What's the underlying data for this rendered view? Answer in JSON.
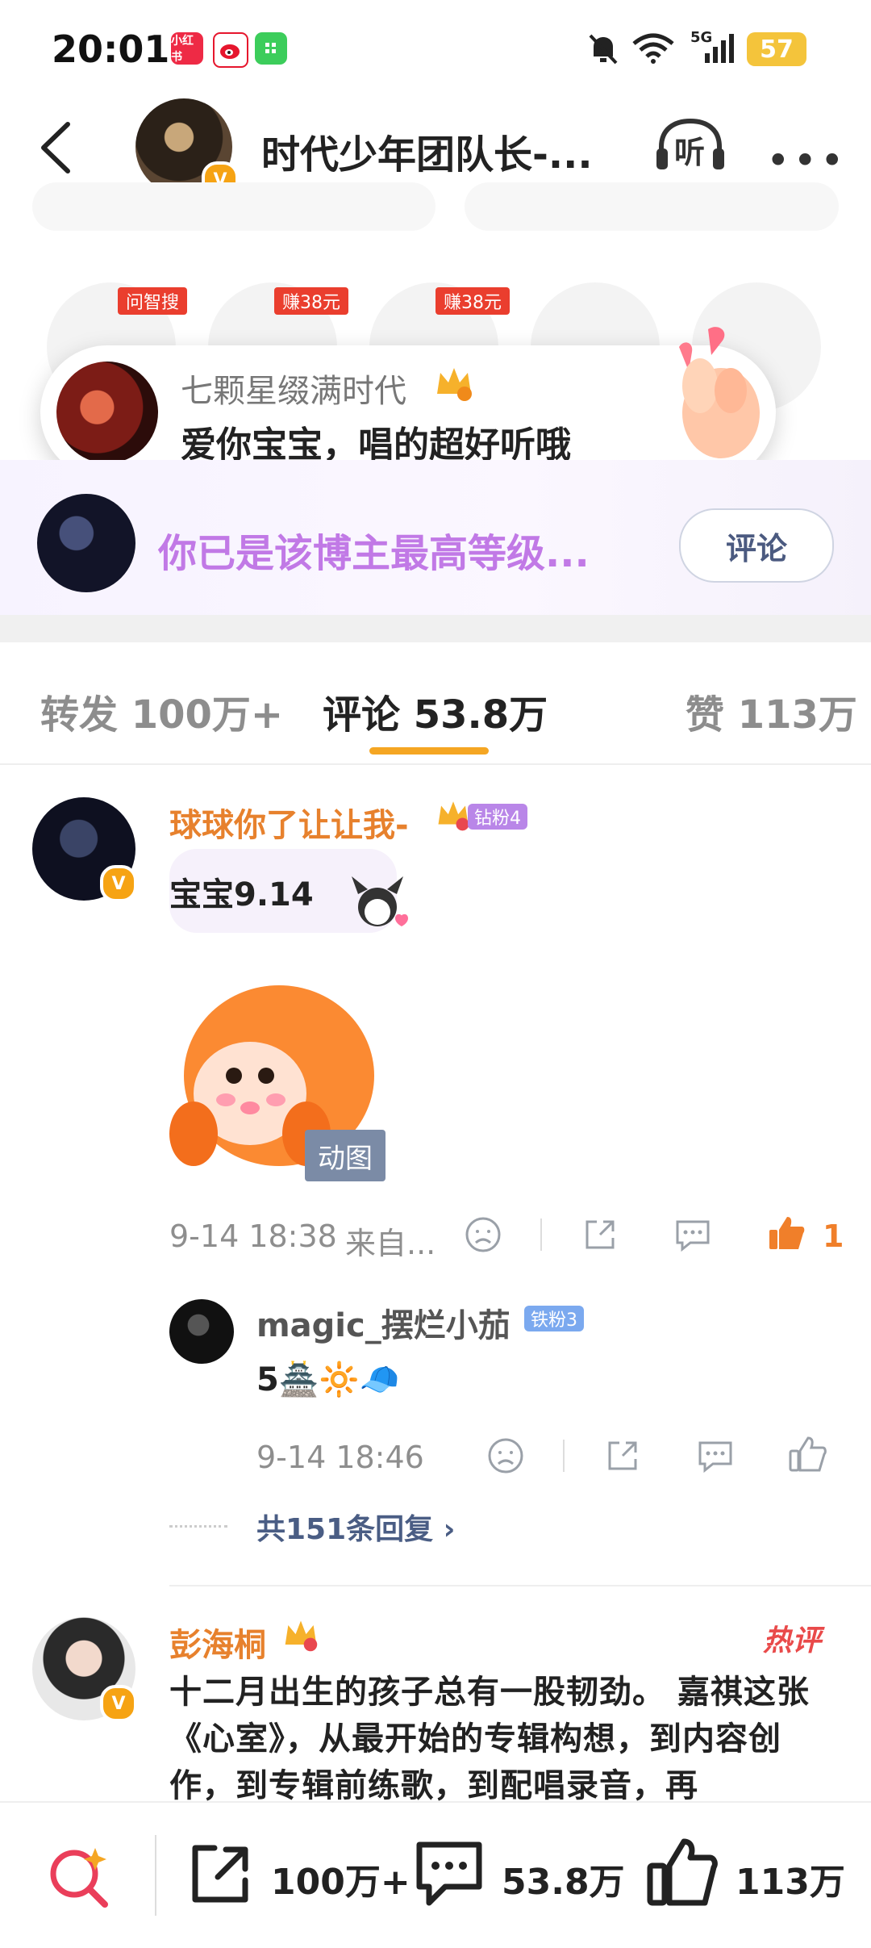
{
  "status_bar": {
    "time": "20:01",
    "apps": [
      "小红书",
      "weibo-icon",
      "wechat-icon"
    ],
    "network": "5G",
    "battery": "57"
  },
  "header": {
    "title": "时代少年团队长-...",
    "listen_label": "听",
    "more_label": "•••"
  },
  "quick_actions": [
    {
      "tag": "问智搜"
    },
    {
      "tag": "赚38元"
    },
    {
      "tag": "赚38元"
    },
    {
      "tag": ""
    },
    {
      "tag": ""
    }
  ],
  "toast": {
    "name": "七颗星缀满时代",
    "message": "爱你宝宝，唱的超好听哦"
  },
  "fan_banner": {
    "text": "你已是该博主最高等级...",
    "button": "评论"
  },
  "tabs": [
    {
      "label": "转发 100万+"
    },
    {
      "label": "评论 53.8万"
    },
    {
      "label": "赞 113万"
    }
  ],
  "comments": [
    {
      "name": "球球你了让让我-",
      "fan_badge": "钻粉4",
      "text": "宝宝9.14",
      "sticker_tag": "动图",
      "time": "9-14 18:38",
      "source": "来自...",
      "likes": "1",
      "reply": {
        "name": "magic_摆烂小茄",
        "fan_badge": "铁粉3",
        "text": "5🏯🔆🧢",
        "time": "9-14 18:46"
      },
      "more_replies": "共151条回复 ›"
    },
    {
      "name": "彭海桐",
      "hot_badge": "热评",
      "text": "十二月出生的孩子总有一股韧劲。 嘉祺这张《心室》，从最开始的专辑构想，到内容创作，到专辑前练歌，到配唱录音，再"
    }
  ],
  "bottom_bar": {
    "repost_count": "100万+",
    "comment_count": "53.8万",
    "like_count": "113万"
  },
  "colors": {
    "accent": "#f5a623",
    "name_orange": "#e7812d",
    "fan_purple": "#c179e6",
    "like_orange": "#f07f2a"
  }
}
